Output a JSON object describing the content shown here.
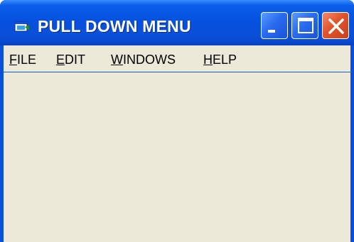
{
  "window": {
    "title": "PULL DOWN MENU",
    "titlebar_color": "#0651e0",
    "client_color": "#ece9d8"
  },
  "titlebar_buttons": [
    {
      "name": "minimize",
      "icon": "minimize-icon"
    },
    {
      "name": "maximize",
      "icon": "maximize-icon"
    },
    {
      "name": "close",
      "icon": "close-icon"
    }
  ],
  "menu": {
    "items": [
      {
        "accel": "F",
        "rest": "ILE"
      },
      {
        "accel": "E",
        "rest": "DIT"
      },
      {
        "accel": "W",
        "rest": "INDOWS"
      },
      {
        "accel": "H",
        "rest": "ELP"
      }
    ]
  }
}
